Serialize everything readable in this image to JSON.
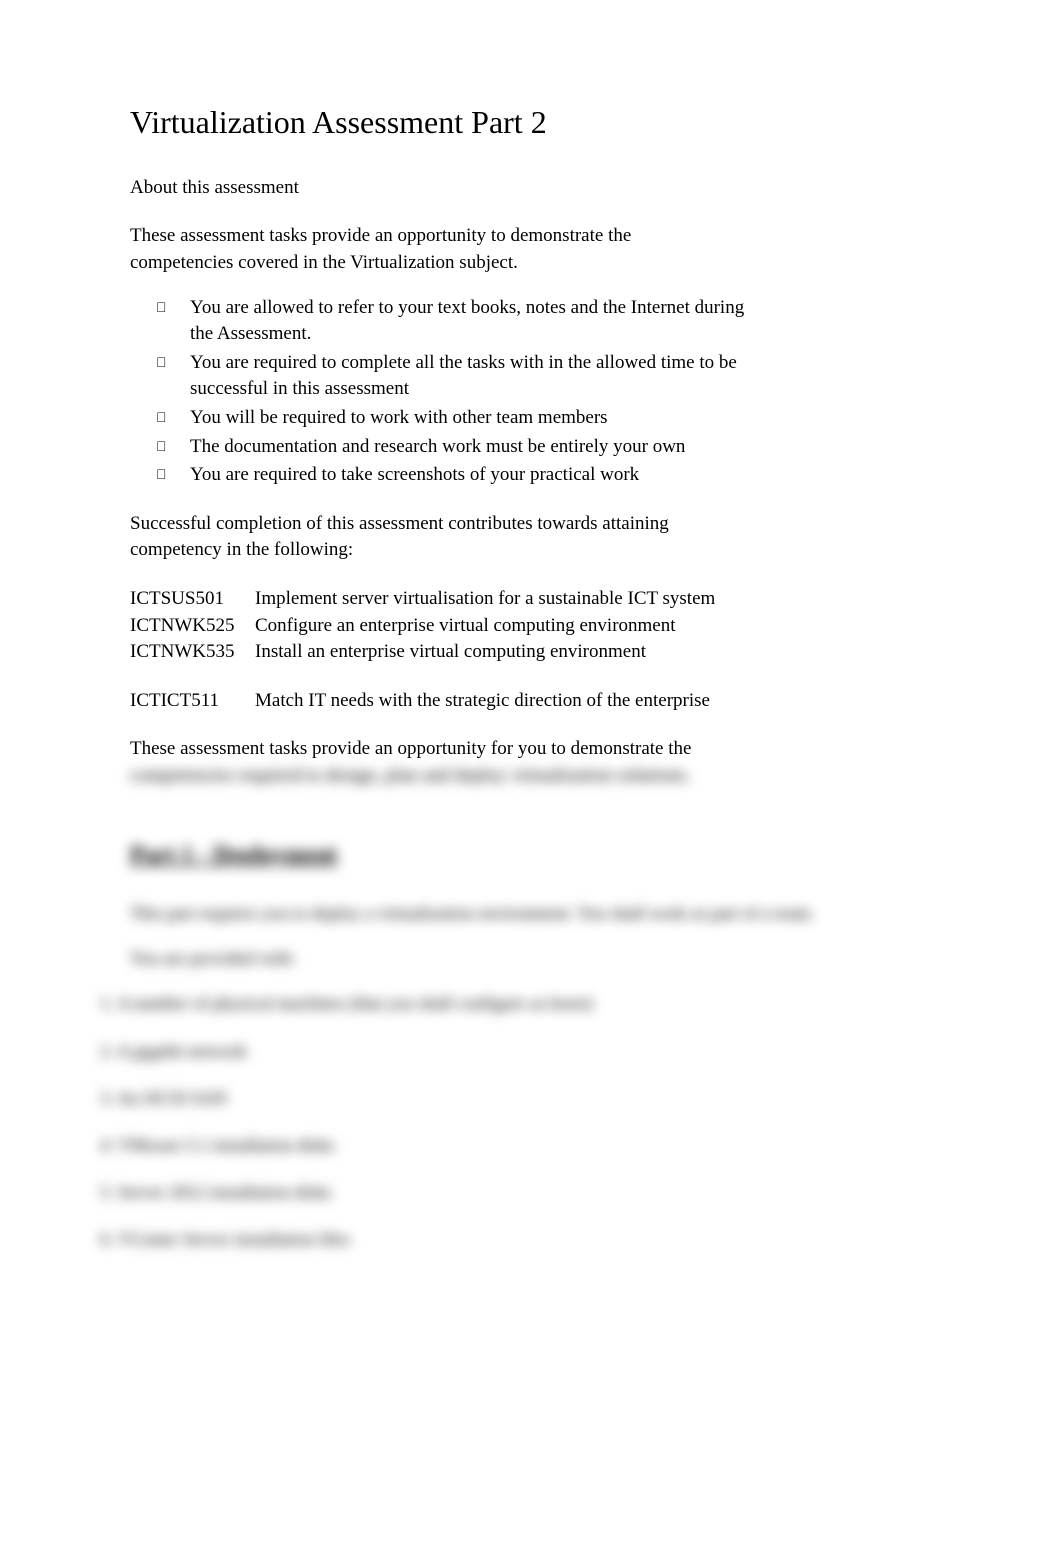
{
  "title": "Virtualization Assessment Part 2",
  "subtitle": "About this assessment",
  "intro": "These assessment tasks provide an opportunity to demonstrate the competencies covered in the Virtualization subject.",
  "bullets": [
    "You are allowed to refer to your text books, notes and the Internet during the Assessment.",
    "You are required to complete all the tasks with in the allowed time to be successful in this assessment",
    "You will be required to work with other team members",
    "The documentation and research work must be entirely your own",
    "You are required to take screenshots of your practical work"
  ],
  "completion_text": "Successful completion of this assessment contributes towards attaining competency in the following:",
  "competencies_group1": [
    {
      "code": "ICTSUS501",
      "desc": "Implement server virtualisation for a sustainable ICT system"
    },
    {
      "code": "ICTNWK525",
      "desc": "Configure an enterprise virtual computing environment"
    },
    {
      "code": "ICTNWK535",
      "desc": "Install an enterprise virtual computing environment"
    }
  ],
  "competencies_group2": [
    {
      "code": "ICTICT511",
      "desc": "Match IT needs with the strategic direction of the enterprise"
    }
  ],
  "closing_clear": "These assessment tasks provide an opportunity for you to demonstrate the",
  "closing_blurred": "competencies required to design, plan and deploy virtualization solutions.",
  "blurred": {
    "heading": "Part 1 - Deployment",
    "line1": "This part requires you to deploy a virtualization environment. You shall work as part of a team.",
    "line2": "You are provided with:",
    "items": [
      "1. A number of physical machines (that you shall configure as hosts)",
      "2. A gigabit network",
      "3. An iSCSI SAN",
      "4. VMware 5.1 installation disks",
      "5. Server 2012 installation disks",
      "6. VCenter Server installation files"
    ]
  }
}
